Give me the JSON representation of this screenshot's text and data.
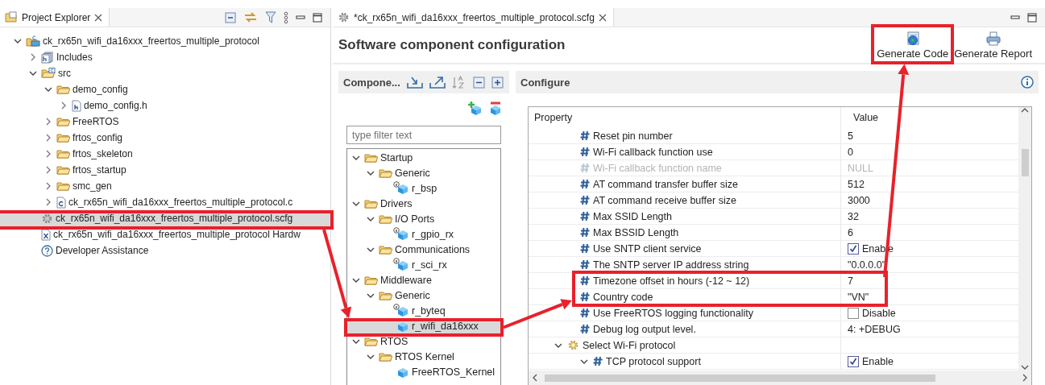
{
  "project_explorer": {
    "tab": "Project Explorer",
    "tree": [
      {
        "label": "ck_rx65n_wifi_da16xxx_freertos_multiple_protocol",
        "kind": "project",
        "expanded": true,
        "selected": false,
        "highlighted": false,
        "children": [
          {
            "label": "Includes",
            "kind": "includes",
            "expanded": false,
            "selected": false,
            "highlighted": false
          },
          {
            "label": "src",
            "kind": "source-folder",
            "expanded": true,
            "selected": false,
            "highlighted": false,
            "children": [
              {
                "label": "demo_config",
                "kind": "folder",
                "expanded": true,
                "selected": false,
                "highlighted": false,
                "children": [
                  {
                    "label": "demo_config.h",
                    "kind": "header-file",
                    "expanded": false,
                    "selected": false,
                    "highlighted": false
                  }
                ]
              },
              {
                "label": "FreeRTOS",
                "kind": "folder",
                "expanded": false,
                "selected": false,
                "highlighted": false
              },
              {
                "label": "frtos_config",
                "kind": "folder",
                "expanded": false,
                "selected": false,
                "highlighted": false
              },
              {
                "label": "frtos_skeleton",
                "kind": "folder",
                "expanded": false,
                "selected": false,
                "highlighted": false
              },
              {
                "label": "frtos_startup",
                "kind": "folder",
                "expanded": false,
                "selected": false,
                "highlighted": false
              },
              {
                "label": "smc_gen",
                "kind": "folder",
                "expanded": false,
                "selected": false,
                "highlighted": false
              },
              {
                "label": "ck_rx65n_wifi_da16xxx_freertos_multiple_protocol.c",
                "kind": "c-file",
                "expanded": false,
                "selected": false,
                "highlighted": false
              }
            ]
          },
          {
            "label": "ck_rx65n_wifi_da16xxx_freertos_multiple_protocol.scfg",
            "kind": "config-file",
            "selected": true,
            "highlighted": true
          },
          {
            "label": "ck_rx65n_wifi_da16xxx_freertos_multiple_protocol Hardw",
            "kind": "xml-file",
            "selected": false,
            "highlighted": false
          },
          {
            "label": "Developer Assistance",
            "kind": "help",
            "selected": false,
            "highlighted": false
          }
        ]
      }
    ]
  },
  "editor": {
    "tab": "*ck_rx65n_wifi_da16xxx_freertos_multiple_protocol.scfg",
    "title": "Software component configuration",
    "actions": [
      {
        "label": "Generate Code",
        "kind": "generate-code",
        "highlighted": true
      },
      {
        "label": "Generate Report",
        "kind": "generate-report",
        "highlighted": false
      }
    ],
    "components": {
      "title": "Compone...",
      "filter_placeholder": "type filter text",
      "tree": [
        {
          "label": "Startup",
          "kind": "folder",
          "expanded": true,
          "selected": false,
          "highlighted": false,
          "children": [
            {
              "label": "Generic",
              "kind": "folder",
              "expanded": true,
              "selected": false,
              "highlighted": false,
              "children": [
                {
                  "label": "r_bsp",
                  "kind": "component-info",
                  "selected": false,
                  "highlighted": false
                }
              ]
            }
          ]
        },
        {
          "label": "Drivers",
          "kind": "folder",
          "expanded": true,
          "selected": false,
          "highlighted": false,
          "children": [
            {
              "label": "I/O Ports",
              "kind": "folder",
              "expanded": true,
              "selected": false,
              "highlighted": false,
              "children": [
                {
                  "label": "r_gpio_rx",
                  "kind": "component-info",
                  "selected": false,
                  "highlighted": false
                }
              ]
            },
            {
              "label": "Communications",
              "kind": "folder",
              "expanded": true,
              "selected": false,
              "highlighted": false,
              "children": [
                {
                  "label": "r_sci_rx",
                  "kind": "component-info",
                  "selected": false,
                  "highlighted": false
                }
              ]
            }
          ]
        },
        {
          "label": "Middleware",
          "kind": "folder",
          "expanded": true,
          "selected": false,
          "highlighted": false,
          "children": [
            {
              "label": "Generic",
              "kind": "folder",
              "expanded": true,
              "selected": false,
              "highlighted": false,
              "children": [
                {
                  "label": "r_byteq",
                  "kind": "component-info",
                  "selected": false,
                  "highlighted": false
                },
                {
                  "label": "r_wifi_da16xxx",
                  "kind": "component",
                  "selected": true,
                  "highlighted": true
                }
              ]
            }
          ]
        },
        {
          "label": "RTOS",
          "kind": "folder",
          "expanded": true,
          "selected": false,
          "highlighted": false,
          "children": [
            {
              "label": "RTOS Kernel",
              "kind": "folder",
              "expanded": true,
              "selected": false,
              "highlighted": false,
              "children": [
                {
                  "label": "FreeRTOS_Kernel",
                  "kind": "component",
                  "selected": false,
                  "highlighted": false
                }
              ]
            }
          ]
        }
      ]
    },
    "configure": {
      "title": "Configure",
      "columns": [
        "Property",
        "Value"
      ],
      "rows": [
        {
          "label": "Reset pin number",
          "kind": "text",
          "value": "5",
          "disabled": false
        },
        {
          "label": "Wi-Fi callback function use",
          "kind": "text",
          "value": "0",
          "disabled": false
        },
        {
          "label": "Wi-Fi callback function name",
          "kind": "text",
          "value": "NULL",
          "disabled": true
        },
        {
          "label": "AT command transfer buffer size",
          "kind": "text",
          "value": "512",
          "disabled": false
        },
        {
          "label": "AT command receive buffer size",
          "kind": "text",
          "value": "3000",
          "disabled": false
        },
        {
          "label": "Max SSID Length",
          "kind": "text",
          "value": "32",
          "disabled": false
        },
        {
          "label": "Max BSSID Length",
          "kind": "text",
          "value": "6",
          "disabled": false
        },
        {
          "label": "Use SNTP client service",
          "kind": "checkbox",
          "value": "Enable",
          "checked": true,
          "disabled": false
        },
        {
          "label": "The SNTP server IP address string",
          "kind": "text",
          "value": "\"0.0.0.0\"",
          "disabled": false
        },
        {
          "label": "Timezone offset in hours (-12 ~ 12)",
          "kind": "text",
          "value": "7",
          "disabled": false,
          "highlighted": true
        },
        {
          "label": "Country code",
          "kind": "text",
          "value": "\"VN\"",
          "disabled": false,
          "highlighted": true
        },
        {
          "label": "Use FreeRTOS logging functionality",
          "kind": "checkbox",
          "value": "Disable",
          "checked": false,
          "disabled": false
        },
        {
          "label": "Debug log output level.",
          "kind": "text",
          "value": "4: +DEBUG",
          "disabled": false
        },
        {
          "label": "Select Wi-Fi protocol",
          "kind": "group",
          "expanded": true,
          "disabled": false,
          "children": [
            {
              "label": "TCP protocol support",
              "kind": "checkbox",
              "value": "Enable",
              "checked": true,
              "expanded": true,
              "disabled": false
            }
          ]
        }
      ]
    }
  }
}
